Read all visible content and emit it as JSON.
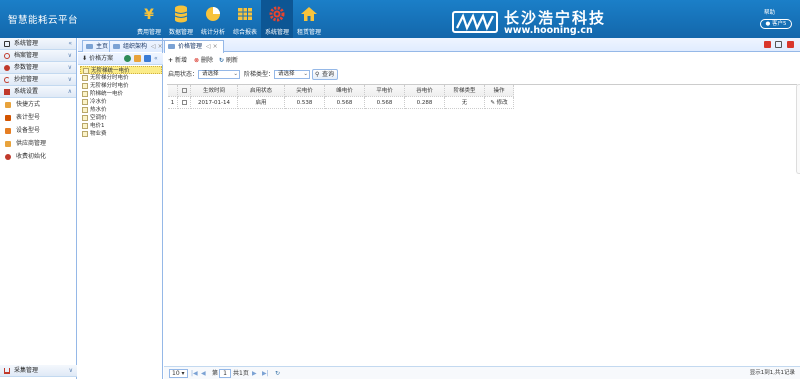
{
  "app": {
    "title": "智慧能耗云平台",
    "help": "帮助",
    "user": "客户5"
  },
  "nav": [
    {
      "label": "费用管理",
      "icon": "yen-icon"
    },
    {
      "label": "数据管理",
      "icon": "database-icon"
    },
    {
      "label": "统计分析",
      "icon": "pie-chart-icon"
    },
    {
      "label": "综合报表",
      "icon": "table-icon"
    },
    {
      "label": "系统管理",
      "icon": "gear-icon",
      "active": true
    },
    {
      "label": "租赁管理",
      "icon": "home-icon"
    }
  ],
  "watermark": {
    "cn": "长沙浩宁科技",
    "url": "www.hooning.cn"
  },
  "sidebar": {
    "groups": [
      {
        "label": "系统管理"
      },
      {
        "label": "档案管理"
      },
      {
        "label": "参数管理"
      },
      {
        "label": "抄控管理"
      },
      {
        "label": "系统设置"
      }
    ],
    "items": [
      {
        "label": "快捷方式"
      },
      {
        "label": "表计型号"
      },
      {
        "label": "设备型号"
      },
      {
        "label": "供应商管理"
      },
      {
        "label": "收费初始化"
      }
    ],
    "bottom": {
      "label": "采集管理"
    }
  },
  "tabs": [
    {
      "label": "主页"
    },
    {
      "label": "组织架构"
    },
    {
      "label": "价格管理"
    }
  ],
  "tree": {
    "title": "价格方案",
    "nodes": [
      "无阶梯统一电价",
      "无阶梯分时电价",
      "无阶梯分时电价",
      "阶梯统一电价",
      "冷水价",
      "热水价",
      "空调价",
      "电价1",
      "物业费"
    ]
  },
  "toolbar": {
    "add": "新增",
    "delete": "删除",
    "refresh": "刷新"
  },
  "filters": {
    "status_label": "启用状态：",
    "status_value": "请选择",
    "ladder_label": "阶梯类型：",
    "ladder_value": "请选择",
    "query": "查询"
  },
  "grid": {
    "headers": [
      "生效时间",
      "启用状态",
      "尖电价",
      "峰电价",
      "平电价",
      "谷电价",
      "阶梯类型",
      "操作"
    ],
    "rows": [
      {
        "index": "1",
        "date": "2017-01-14",
        "status": "启用",
        "c1": "0.538",
        "c2": "0.568",
        "c3": "0.568",
        "c4": "0.288",
        "ladder": "无",
        "op": "修改"
      }
    ]
  },
  "pager": {
    "size": "10",
    "page": "1",
    "total_pages": "共1页",
    "summary": "显示1到1,共1记录"
  },
  "colors": {
    "topbar": "#1672b9",
    "active_nav": "#0d5694",
    "border": "#95b8e7"
  }
}
